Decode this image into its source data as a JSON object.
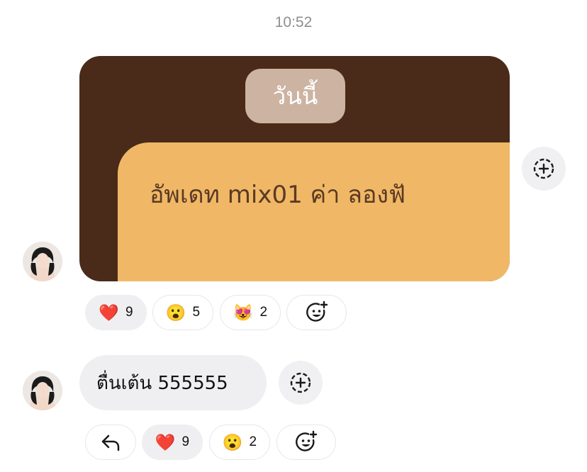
{
  "timestamp": "10:52",
  "image_message": {
    "date_chip": "วันนี้",
    "card_text": "อัพเดท mix01 ค่า ลองฟั"
  },
  "image_reactions": [
    {
      "emoji": "❤️",
      "icon": "red-heart-icon",
      "count": "9"
    },
    {
      "emoji": "😮",
      "icon": "surprised-face-icon",
      "count": "5"
    },
    {
      "emoji": "😻",
      "icon": "heart-eyes-cat-icon",
      "count": "2"
    }
  ],
  "text_message": {
    "text": "ตื่นเต้น 555555"
  },
  "text_reactions": [
    {
      "emoji": "❤️",
      "icon": "red-heart-icon",
      "count": "9"
    },
    {
      "emoji": "😮",
      "icon": "surprised-face-icon",
      "count": "2"
    }
  ],
  "colors": {
    "image_background": "#4a2a19",
    "card_background": "#f0b866",
    "date_chip": "#cdb3a2",
    "bubble_gray": "#efeff2"
  }
}
